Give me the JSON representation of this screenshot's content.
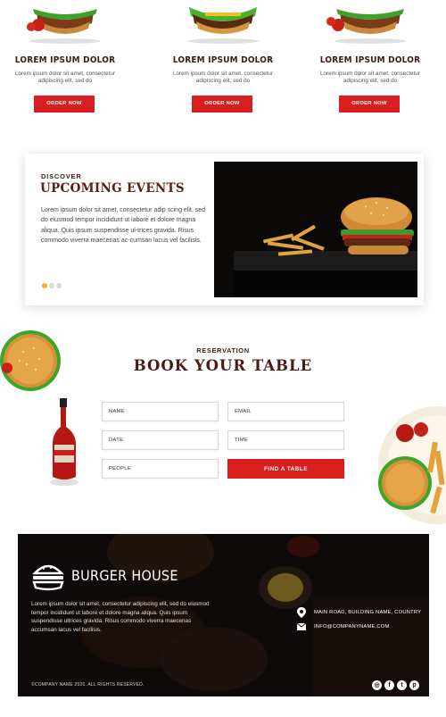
{
  "products": [
    {
      "title": "LOREM IPSUM DOLOR",
      "description": "Lorem ipsum dolor sit amet, consectetur adipiscing elit, sed do",
      "button": "ORDER NOW"
    },
    {
      "title": "LOREM IPSUM DOLOR",
      "description": "Lorem ipsum dolor sit amet, consectetur adipiscing elit, sed do",
      "button": "ORDER NOW"
    },
    {
      "title": "LOREM IPSUM DOLOR",
      "description": "Lorem ipsum dolor sit amet, consectetur adipiscing elit, sed do",
      "button": "ORDER NOW"
    }
  ],
  "events": {
    "kicker": "DISCOVER",
    "heading": "UPCOMING EVENTS",
    "body": "Lorem ipsum dolor sit amet, consectetur adip scing elit, sed do eiusmod tempor incididunt ut labore et dolore magna aliqua. Quis ipsum suspendisse ul-trices gravida. Risus commodo viverra maecenas ac-cumsan lacus vel facilisis.",
    "slides_total": 3,
    "active_slide": 1
  },
  "reservation": {
    "kicker": "RESERVATION",
    "title": "BOOK YOUR TABLE",
    "fields": {
      "name": "NAME",
      "email": "EMAIL",
      "date": "DATE",
      "time": "TIME",
      "people": "PEOPLE"
    },
    "submit": "FIND A TABLE"
  },
  "footer": {
    "brand": "BURGER HOUSE",
    "description": "Lorem ipsum dolor sit amet, consectetur adipiscing elit, sed do eiusmod tempor incididunt ut labore et dolore magna aliqua. Quis ipsum suspendisse ultrices gravida. Risus commodo viverra maecenas accumsan lacus vel facilisis.",
    "address": "MAIN ROAD, BUILDING NAME, COUNTRY",
    "email": "INFO@COMPANYNAME.COM",
    "copyright": "©COMPANY NAME 2020. ALL RIGHTS RESERVED.",
    "social": [
      "instagram-icon",
      "facebook-icon",
      "twitter-icon",
      "pinterest-icon"
    ]
  },
  "colors": {
    "accent_red": "#d81e1e",
    "heading_brown": "#4d1a12",
    "dot_active": "#f2b90f",
    "footer_bg": "#1b1412"
  }
}
